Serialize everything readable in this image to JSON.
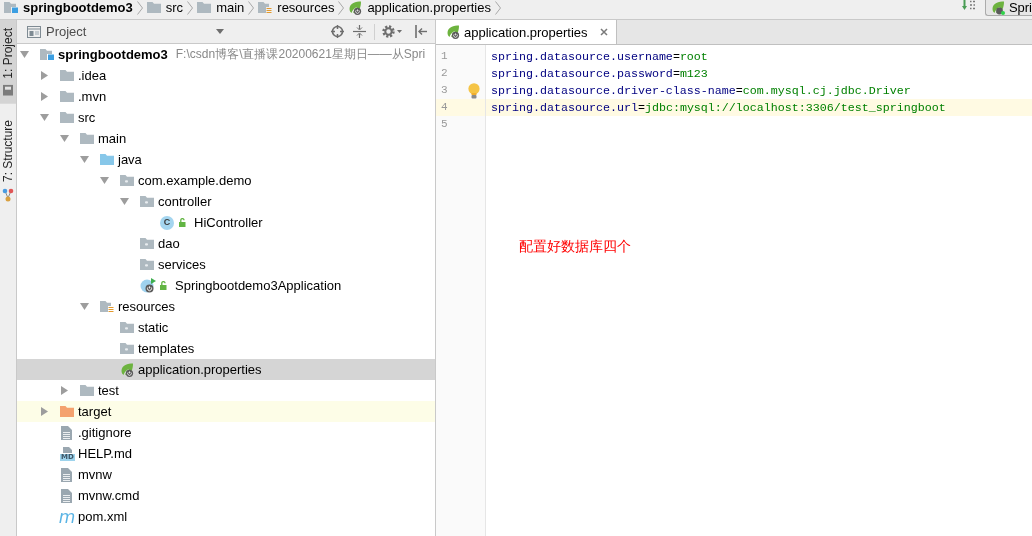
{
  "breadcrumbs": [
    {
      "label": "springbootdemo3",
      "kind": "module"
    },
    {
      "label": "src",
      "kind": "folder"
    },
    {
      "label": "main",
      "kind": "folder"
    },
    {
      "label": "resources",
      "kind": "resources-root"
    },
    {
      "label": "application.properties",
      "kind": "properties"
    }
  ],
  "toolbar": {
    "run_configuration": "Spri"
  },
  "tool_strip": [
    {
      "label": "1: Project",
      "kind": "project",
      "selected": true
    },
    {
      "label": "7: Structure",
      "kind": "structure",
      "selected": false
    }
  ],
  "project_panel": {
    "title": "Project",
    "tree": [
      {
        "label": "springbootdemo3",
        "path": "F:\\csdn博客\\直播课20200621星期日——从Spri",
        "kind": "module",
        "expanded": true,
        "selected": false,
        "highlighted": false,
        "locked": false,
        "children": [
          {
            "label": ".idea",
            "kind": "folder",
            "expanded": false,
            "selected": false,
            "highlighted": false,
            "locked": false
          },
          {
            "label": ".mvn",
            "kind": "folder",
            "expanded": false,
            "selected": false,
            "highlighted": false,
            "locked": false
          },
          {
            "label": "src",
            "kind": "folder",
            "expanded": true,
            "selected": false,
            "highlighted": false,
            "locked": false,
            "children": [
              {
                "label": "main",
                "kind": "folder",
                "expanded": true,
                "selected": false,
                "highlighted": false,
                "locked": false,
                "children": [
                  {
                    "label": "java",
                    "kind": "source-root",
                    "expanded": true,
                    "selected": false,
                    "highlighted": false,
                    "locked": false,
                    "children": [
                      {
                        "label": "com.example.demo",
                        "kind": "package",
                        "expanded": true,
                        "selected": false,
                        "highlighted": false,
                        "locked": false,
                        "children": [
                          {
                            "label": "controller",
                            "kind": "package",
                            "expanded": true,
                            "selected": false,
                            "highlighted": false,
                            "locked": false,
                            "children": [
                              {
                                "label": "HiController",
                                "kind": "class",
                                "badge": "C",
                                "selected": false,
                                "highlighted": false,
                                "locked": true
                              }
                            ]
                          },
                          {
                            "label": "dao",
                            "kind": "package",
                            "selected": false,
                            "highlighted": false,
                            "locked": false
                          },
                          {
                            "label": "services",
                            "kind": "package",
                            "selected": false,
                            "highlighted": false,
                            "locked": false
                          },
                          {
                            "label": "Springbootdemo3Application",
                            "kind": "spring-app",
                            "selected": false,
                            "highlighted": false,
                            "locked": true
                          }
                        ]
                      }
                    ]
                  },
                  {
                    "label": "resources",
                    "kind": "resources-root",
                    "expanded": true,
                    "selected": false,
                    "highlighted": false,
                    "locked": false,
                    "children": [
                      {
                        "label": "static",
                        "kind": "package",
                        "selected": false,
                        "highlighted": false,
                        "locked": false
                      },
                      {
                        "label": "templates",
                        "kind": "package",
                        "selected": false,
                        "highlighted": false,
                        "locked": false
                      },
                      {
                        "label": "application.properties",
                        "kind": "properties",
                        "selected": true,
                        "highlighted": false,
                        "locked": false
                      }
                    ]
                  }
                ]
              },
              {
                "label": "test",
                "kind": "folder",
                "expanded": false,
                "selected": false,
                "highlighted": false,
                "locked": false
              }
            ]
          },
          {
            "label": "target",
            "kind": "excluded",
            "expanded": false,
            "selected": false,
            "highlighted": true,
            "locked": false
          },
          {
            "label": ".gitignore",
            "kind": "text-file",
            "selected": false,
            "highlighted": false,
            "locked": false
          },
          {
            "label": "HELP.md",
            "kind": "markdown",
            "badge": "MD",
            "selected": false,
            "highlighted": false,
            "locked": false
          },
          {
            "label": "mvnw",
            "kind": "text-file",
            "selected": false,
            "highlighted": false,
            "locked": false
          },
          {
            "label": "mvnw.cmd",
            "kind": "text-file",
            "selected": false,
            "highlighted": false,
            "locked": false
          },
          {
            "label": "pom.xml",
            "kind": "maven",
            "badge": "m",
            "selected": false,
            "highlighted": false,
            "locked": false
          }
        ]
      }
    ]
  },
  "editor": {
    "tabs": [
      {
        "label": "application.properties",
        "kind": "properties",
        "selected": true
      }
    ],
    "lines": [
      {
        "number": "1",
        "key": "spring.datasource.username",
        "operator": "=",
        "value": "root",
        "current": false,
        "bulb": false
      },
      {
        "number": "2",
        "key": "spring.datasource.password",
        "operator": "=",
        "value": "m123",
        "current": false,
        "bulb": false
      },
      {
        "number": "3",
        "key": "spring.datasource.driver-class-name",
        "operator": "=",
        "value": "com.mysql.cj.jdbc.Driver",
        "current": false,
        "bulb": true
      },
      {
        "number": "4",
        "key": "spring.datasource.url",
        "operator": "=",
        "value": "jdbc:mysql://localhost:3306/test_springboot",
        "current": true,
        "bulb": false
      },
      {
        "number": "5",
        "current": false,
        "bulb": false
      }
    ],
    "annotation": "配置好数据库四个"
  }
}
